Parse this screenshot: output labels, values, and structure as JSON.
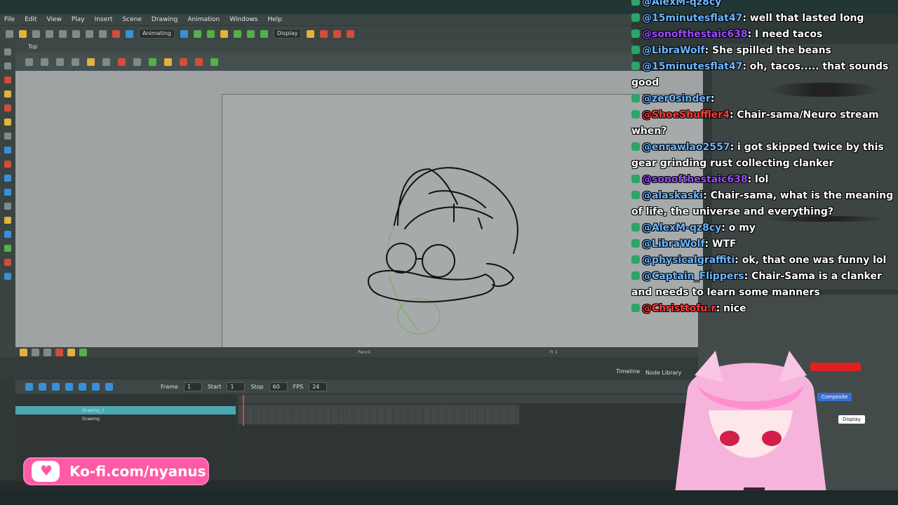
{
  "menu": [
    "File",
    "Edit",
    "View",
    "Play",
    "Insert",
    "Scene",
    "Drawing",
    "Animation",
    "Windows",
    "Help"
  ],
  "toolbar": {
    "mode": "Animating",
    "display": "Display"
  },
  "view": {
    "title": "Top"
  },
  "status": {
    "tool": "Pencil",
    "frame": "Fr 1"
  },
  "timeline": {
    "frame_label": "Frame",
    "frame": "1",
    "start_label": "Start",
    "start": "1",
    "stop_label": "Stop",
    "stop": "60",
    "fps_label": "FPS",
    "fps": "24",
    "tab_timeline": "Timeline",
    "tab_node": "Node Library",
    "layers": [
      "Drawing_1",
      "Drawing"
    ]
  },
  "nodes": {
    "composite": "Composite",
    "display": "Display"
  },
  "kofi": {
    "text": "Ko-fi.com/nyanus"
  },
  "chat": [
    {
      "user": "@AlexM-qz8cy",
      "color": "blue",
      "text": ""
    },
    {
      "user": "@15minutesflat47",
      "color": "blue",
      "text": ": well that lasted long"
    },
    {
      "user": "@sonofthestaic638",
      "color": "purple",
      "text": ": I need tacos"
    },
    {
      "user": "@LibraWolf",
      "color": "blue",
      "text": ": She spilled the beans"
    },
    {
      "user": "@15minutesflat47",
      "color": "blue",
      "text": ": oh, tacos..... that sounds good"
    },
    {
      "user": "@zer0sinder",
      "color": "blue",
      "text": ":"
    },
    {
      "user": "@ShoeShuffler4",
      "color": "red",
      "text": ": Chair-sama/Neuro stream when?"
    },
    {
      "user": "@enrawlao2557",
      "color": "blue",
      "text": ": i got skipped twice by this gear grinding rust collecting clanker"
    },
    {
      "user": "@sonofthestaic638",
      "color": "purple",
      "text": ": lol"
    },
    {
      "user": "@alaskaski",
      "color": "blue",
      "text": ": Chair-sama, what is the meaning of life, the universe and everything?"
    },
    {
      "user": "@AlexM-qz8cy",
      "color": "blue",
      "text": ": o my"
    },
    {
      "user": "@LibraWolf",
      "color": "blue",
      "text": ": WTF"
    },
    {
      "user": "@physicalgraffiti",
      "color": "blue",
      "text": ": ok, that one was funny lol"
    },
    {
      "user": "@Captain_Flippers",
      "color": "blue",
      "text": ": Chair-Sama is a clanker and needs to learn some manners"
    },
    {
      "user": "@Christtofu.r",
      "color": "red",
      "text": ": nice"
    }
  ],
  "colors": {
    "kofi": "#ff5aa5",
    "accent": "#4aa7b2",
    "viewport": "#9fa3a3"
  }
}
